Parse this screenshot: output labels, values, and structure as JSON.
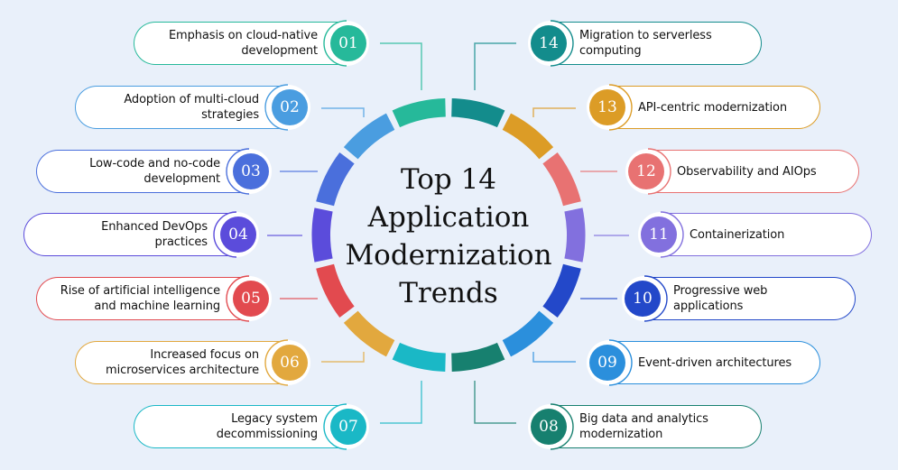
{
  "title_lines": [
    "Top 14",
    "Application",
    "Modernization",
    "Trends"
  ],
  "trends": [
    {
      "num": "01",
      "label": "Emphasis on cloud-native development",
      "lines": [
        "Emphasis on cloud-native",
        "development"
      ],
      "color": "#26b99a"
    },
    {
      "num": "02",
      "label": "Adoption of multi-cloud strategies",
      "lines": [
        "Adoption of multi-cloud",
        "strategies"
      ],
      "color": "#4a9de0"
    },
    {
      "num": "03",
      "label": "Low-code and no-code development",
      "lines": [
        "Low-code and no-code",
        "development"
      ],
      "color": "#4a6fdc"
    },
    {
      "num": "04",
      "label": "Enhanced DevOps practices",
      "lines": [
        "Enhanced DevOps",
        "practices"
      ],
      "color": "#5b4cdb"
    },
    {
      "num": "05",
      "label": "Rise of artificial intelligence and machine learning",
      "lines": [
        "Rise of artificial intelligence",
        "and machine learning"
      ],
      "color": "#e24a4f"
    },
    {
      "num": "06",
      "label": "Increased focus on microservices architecture",
      "lines": [
        "Increased focus on",
        "microservices architecture"
      ],
      "color": "#e2a83e"
    },
    {
      "num": "07",
      "label": "Legacy system decommissioning",
      "lines": [
        "Legacy system",
        "decommissioning"
      ],
      "color": "#1ab8c6"
    },
    {
      "num": "08",
      "label": "Big data and analytics modernization",
      "lines": [
        "Big data and analytics",
        "modernization"
      ],
      "color": "#17806f"
    },
    {
      "num": "09",
      "label": "Event-driven architectures",
      "lines": [
        "Event-driven architectures"
      ],
      "color": "#2b8fdc"
    },
    {
      "num": "10",
      "label": "Progressive web applications",
      "lines": [
        "Progressive web",
        "applications"
      ],
      "color": "#2348c9"
    },
    {
      "num": "11",
      "label": "Containerization",
      "lines": [
        "Containerization"
      ],
      "color": "#8270de"
    },
    {
      "num": "12",
      "label": "Observability and AIOps",
      "lines": [
        "Observability and AIOps"
      ],
      "color": "#e87272"
    },
    {
      "num": "13",
      "label": "API-centric modernization",
      "lines": [
        "API-centric modernization"
      ],
      "color": "#dc9c26"
    },
    {
      "num": "14",
      "label": "Migration to serverless computing",
      "lines": [
        "Migration to serverless",
        "computing"
      ],
      "color": "#138c8c"
    }
  ]
}
